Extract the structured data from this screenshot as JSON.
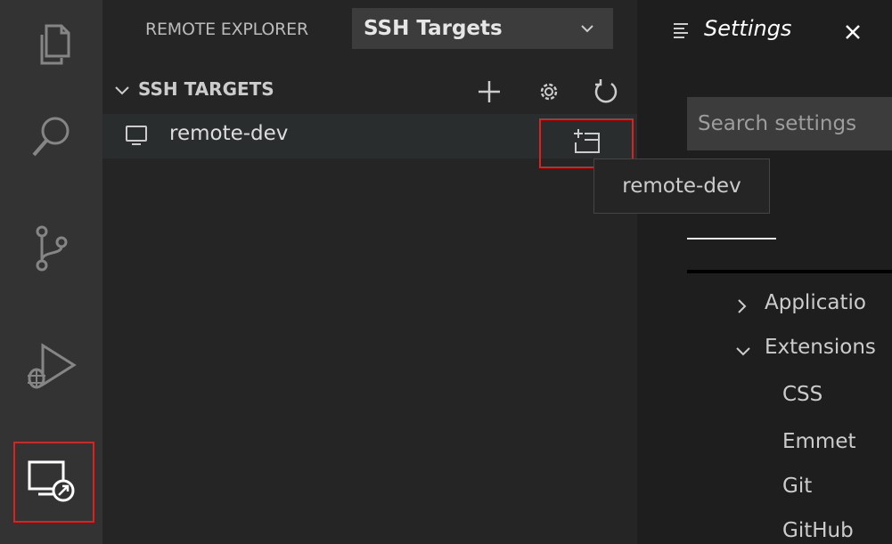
{
  "activity_bar": {
    "items": [
      {
        "name": "explorer-icon"
      },
      {
        "name": "search-icon"
      },
      {
        "name": "source-control-icon"
      },
      {
        "name": "run-debug-icon"
      },
      {
        "name": "remote-explorer-icon"
      }
    ]
  },
  "sidebar": {
    "title": "REMOTE EXPLORER",
    "target_select": {
      "value": "SSH Targets"
    },
    "section": {
      "title": "SSH TARGETS",
      "actions": [
        "add-icon",
        "gear-icon",
        "refresh-icon"
      ]
    },
    "tree": {
      "items": [
        {
          "label": "remote-dev",
          "icon": "monitor-icon",
          "action_icon": "connect-new-window-icon"
        }
      ]
    },
    "tooltip": "remote-dev"
  },
  "editor": {
    "tab": {
      "label": "Settings",
      "icon": "settings-file-icon",
      "close_icon": "close-icon"
    },
    "search": {
      "placeholder": "Search settings"
    },
    "toc": [
      {
        "label": "Applicatio",
        "collapsed": true
      },
      {
        "label": "Extensions",
        "collapsed": false
      },
      {
        "label": "CSS"
      },
      {
        "label": "Emmet"
      },
      {
        "label": "Git"
      },
      {
        "label": "GitHub"
      }
    ]
  },
  "colors": {
    "activity_bar": "#333333",
    "sidebar": "#252526",
    "editor": "#1e1e1e",
    "highlight_box": "#e01f1f",
    "row_hover": "#2a2d2e"
  }
}
